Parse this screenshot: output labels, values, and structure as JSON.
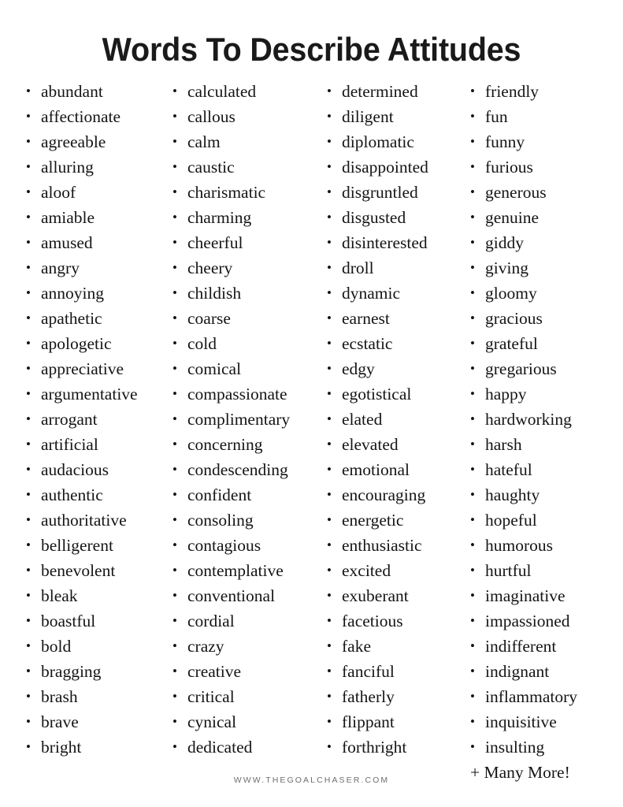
{
  "page": {
    "title": "Words To Describe Attitudes",
    "footer": "WWW.THEGOALCHASER.COM",
    "text_color": "#151515",
    "title_color": "#1a1a1a",
    "footer_color": "#6f6f6f",
    "background_color": "#ffffff",
    "bullet_glyph": "•"
  },
  "columns": [
    {
      "index": 0,
      "words": [
        "abundant",
        "affectionate",
        "agreeable",
        "alluring",
        "aloof",
        "amiable",
        "amused",
        "angry",
        "annoying",
        "apathetic",
        "apologetic",
        "appreciative",
        "argumentative",
        "arrogant",
        "artificial",
        "audacious",
        "authentic",
        "authoritative",
        "belligerent",
        "benevolent",
        "bleak",
        "boastful",
        "bold",
        "bragging",
        "brash",
        "brave",
        "bright"
      ]
    },
    {
      "index": 1,
      "words": [
        "calculated",
        "callous",
        "calm",
        "caustic",
        "charismatic",
        "charming",
        "cheerful",
        "cheery",
        "childish",
        "coarse",
        "cold",
        "comical",
        "compassionate",
        "complimentary",
        "concerning",
        "condescending",
        "confident",
        "consoling",
        "contagious",
        "contemplative",
        "conventional",
        "cordial",
        "crazy",
        "creative",
        "critical",
        "cynical",
        "dedicated"
      ]
    },
    {
      "index": 2,
      "words": [
        "determined",
        "diligent",
        "diplomatic",
        "disappointed",
        "disgruntled",
        "disgusted",
        "disinterested",
        "droll",
        "dynamic",
        "earnest",
        "ecstatic",
        "edgy",
        "egotistical",
        "elated",
        "elevated",
        "emotional",
        "encouraging",
        "energetic",
        "enthusiastic",
        "excited",
        "exuberant",
        "facetious",
        "fake",
        "fanciful",
        "fatherly",
        "flippant",
        "forthright"
      ]
    },
    {
      "index": 3,
      "words": [
        "friendly",
        "fun",
        "funny",
        "furious",
        "generous",
        "genuine",
        "giddy",
        "giving",
        "gloomy",
        "gracious",
        "grateful",
        "gregarious",
        "happy",
        "hardworking",
        "harsh",
        "hateful",
        "haughty",
        "hopeful",
        "humorous",
        "hurtful",
        "imaginative",
        "impassioned",
        "indifferent",
        "indignant",
        "inflammatory",
        "inquisitive",
        "insulting"
      ],
      "footer_note": "+ Many More!"
    }
  ]
}
